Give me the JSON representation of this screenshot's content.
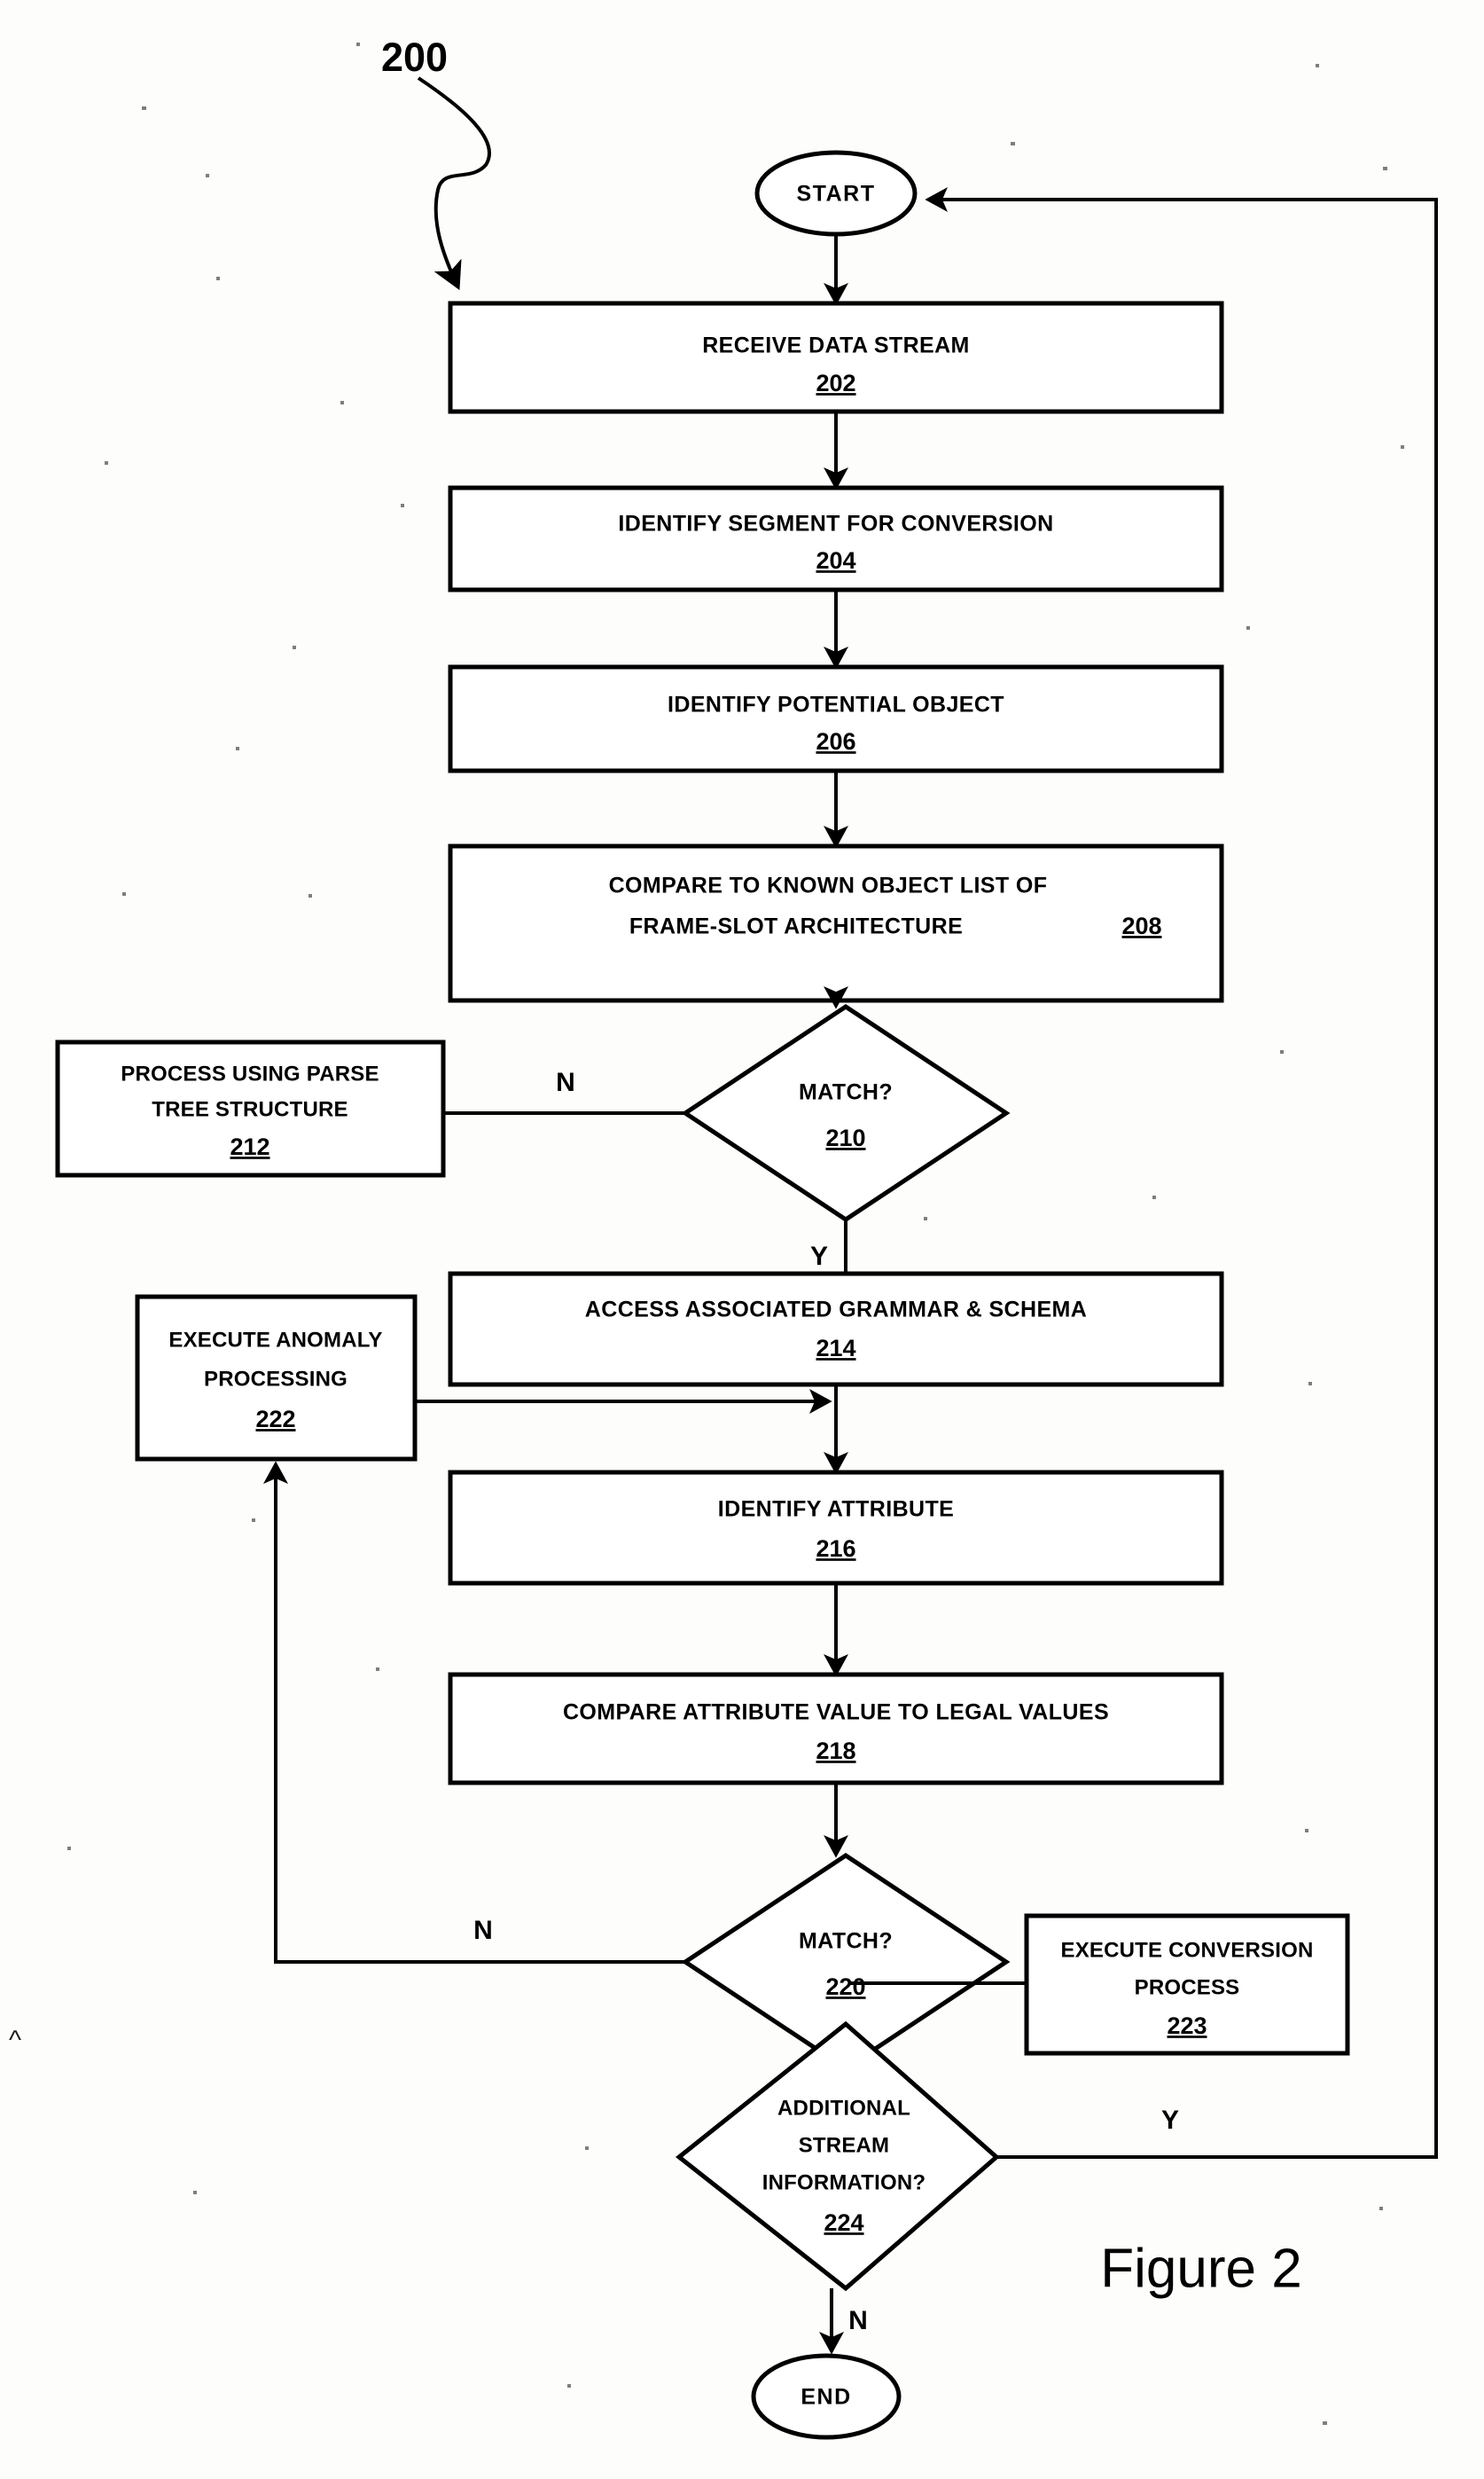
{
  "figure": {
    "caption": "Figure 2",
    "callout_number": "200"
  },
  "terminals": {
    "start": {
      "label": "START"
    },
    "end": {
      "label": "END"
    }
  },
  "branch_labels": {
    "match210_no": "N",
    "match210_yes": "Y",
    "match220_no": "N",
    "additional224_yes": "Y",
    "additional224_no": "N"
  },
  "nodes": [
    {
      "id": "202",
      "ref": "202",
      "lines": [
        "RECEIVE DATA STREAM"
      ],
      "shape": "process"
    },
    {
      "id": "204",
      "ref": "204",
      "lines": [
        "IDENTIFY SEGMENT FOR CONVERSION"
      ],
      "shape": "process"
    },
    {
      "id": "206",
      "ref": "206",
      "lines": [
        "IDENTIFY POTENTIAL OBJECT"
      ],
      "shape": "process"
    },
    {
      "id": "208",
      "ref": "208",
      "lines": [
        "COMPARE TO KNOWN OBJECT LIST OF",
        "FRAME-SLOT ARCHITECTURE"
      ],
      "shape": "process"
    },
    {
      "id": "210",
      "ref": "210",
      "lines": [
        "MATCH?"
      ],
      "shape": "decision"
    },
    {
      "id": "212",
      "ref": "212",
      "lines": [
        "PROCESS USING PARSE",
        "TREE STRUCTURE"
      ],
      "shape": "process"
    },
    {
      "id": "214",
      "ref": "214",
      "lines": [
        "ACCESS ASSOCIATED GRAMMAR & SCHEMA"
      ],
      "shape": "process"
    },
    {
      "id": "216",
      "ref": "216",
      "lines": [
        "IDENTIFY ATTRIBUTE"
      ],
      "shape": "process"
    },
    {
      "id": "218",
      "ref": "218",
      "lines": [
        "COMPARE ATTRIBUTE VALUE TO LEGAL VALUES"
      ],
      "shape": "process"
    },
    {
      "id": "220",
      "ref": "220",
      "lines": [
        "MATCH?"
      ],
      "shape": "decision"
    },
    {
      "id": "222",
      "ref": "222",
      "lines": [
        "EXECUTE ANOMALY",
        "PROCESSING"
      ],
      "shape": "process"
    },
    {
      "id": "223",
      "ref": "223",
      "lines": [
        "EXECUTE CONVERSION",
        "PROCESS"
      ],
      "shape": "process"
    },
    {
      "id": "224",
      "ref": "224",
      "lines": [
        "ADDITIONAL",
        "STREAM",
        "INFORMATION?"
      ],
      "shape": "decision"
    }
  ],
  "text": {
    "n202_l1": "RECEIVE DATA STREAM",
    "n202_ref": "202",
    "n204_l1": "IDENTIFY SEGMENT FOR CONVERSION",
    "n204_ref": "204",
    "n206_l1": "IDENTIFY POTENTIAL OBJECT",
    "n206_ref": "206",
    "n208_l1": "COMPARE TO KNOWN OBJECT LIST OF",
    "n208_l2": "FRAME-SLOT ARCHITECTURE",
    "n208_ref": "208",
    "n210_l1": "MATCH?",
    "n210_ref": "210",
    "n212_l1": "PROCESS USING PARSE",
    "n212_l2": "TREE STRUCTURE",
    "n212_ref": "212",
    "n214_l1": "ACCESS ASSOCIATED GRAMMAR & SCHEMA",
    "n214_ref": "214",
    "n216_l1": "IDENTIFY ATTRIBUTE",
    "n216_ref": "216",
    "n218_l1": "COMPARE ATTRIBUTE VALUE TO LEGAL VALUES",
    "n218_ref": "218",
    "n220_l1": "MATCH?",
    "n220_ref": "220",
    "n222_l1": "EXECUTE ANOMALY",
    "n222_l2": "PROCESSING",
    "n222_ref": "222",
    "n223_l1": "EXECUTE CONVERSION",
    "n223_l2": "PROCESS",
    "n223_ref": "223",
    "n224_l1": "ADDITIONAL",
    "n224_l2": "STREAM",
    "n224_l3": "INFORMATION?",
    "n224_ref": "224"
  },
  "colors": {
    "ink": "#000000",
    "paper": "#fdfdfb"
  }
}
